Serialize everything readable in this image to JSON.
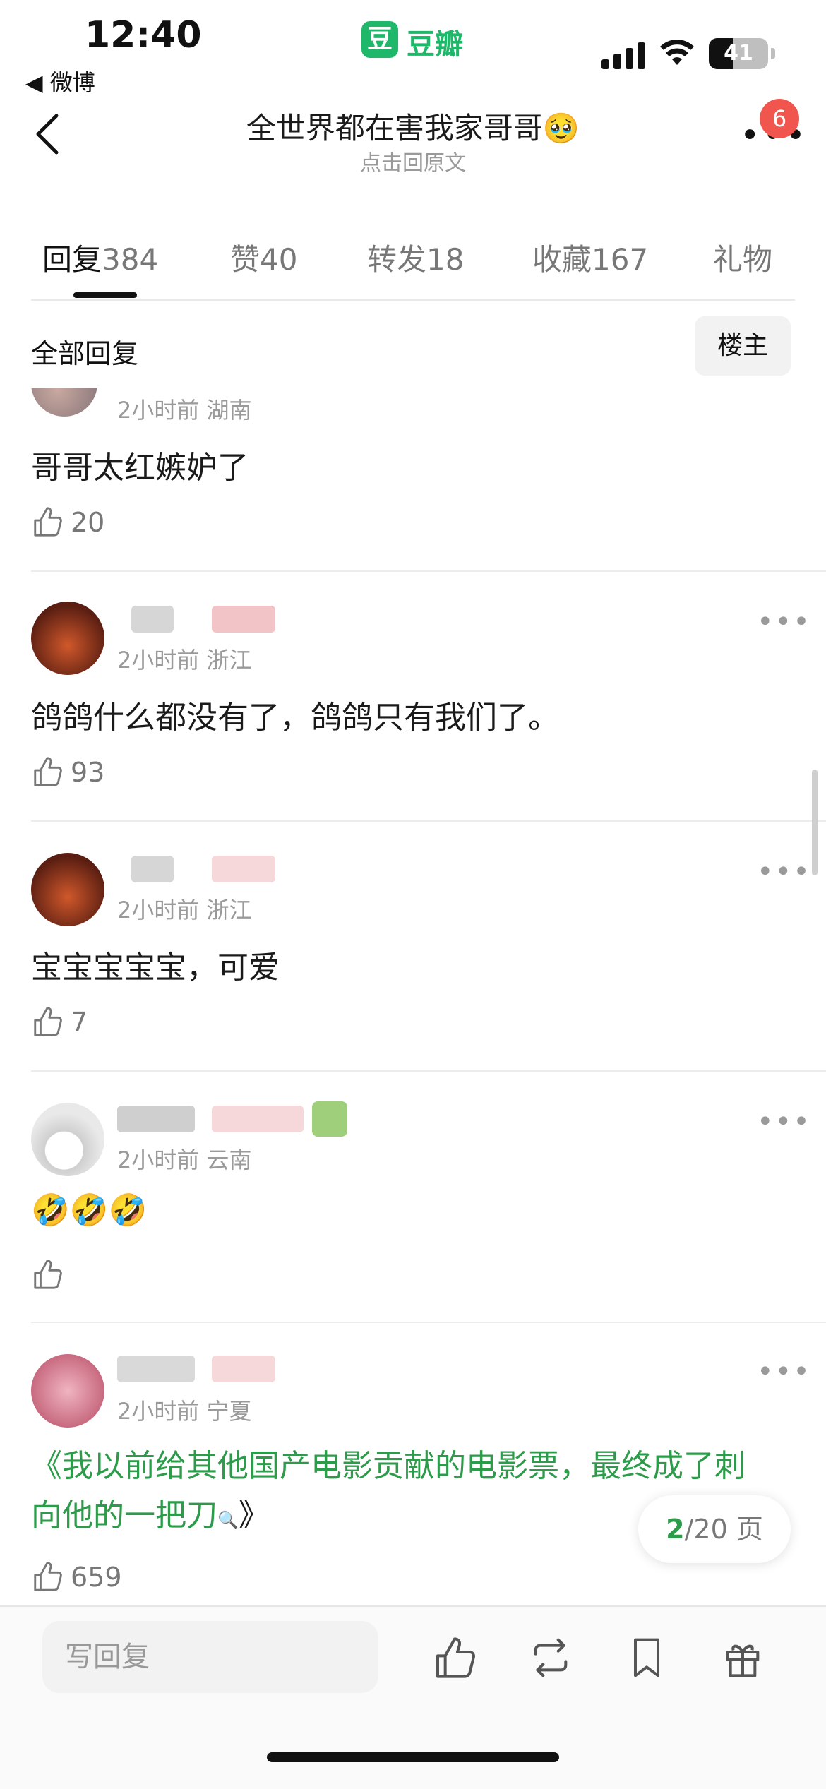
{
  "status_bar": {
    "time": "12:40",
    "back_app": "◀ 微博",
    "battery": "41",
    "battery_level": 0.41
  },
  "app": {
    "logo_char": "豆",
    "name": "豆瓣"
  },
  "nav": {
    "title": "全世界都在害我家哥哥🥹",
    "subtitle": "点击回原文",
    "badge": "6"
  },
  "tabs": [
    {
      "label": "回复",
      "count": "384"
    },
    {
      "label": "赞",
      "count": "40"
    },
    {
      "label": "转发",
      "count": "18"
    },
    {
      "label": "收藏",
      "count": "167"
    },
    {
      "label": "礼物",
      "count": ""
    }
  ],
  "filter": {
    "label": "全部回复",
    "button": "楼主"
  },
  "comments": [
    {
      "meta": "2小时前 湖南",
      "text": "哥哥太红嫉妒了",
      "likes": "20"
    },
    {
      "meta": "2小时前 浙江",
      "text": "鸽鸽什么都没有了，鸽鸽只有我们了。",
      "likes": "93"
    },
    {
      "meta": "2小时前 浙江",
      "text": "宝宝宝宝宝，可爱",
      "likes": "7"
    },
    {
      "meta": "2小时前 云南",
      "text": "🤣🤣🤣",
      "likes": ""
    },
    {
      "meta": "2小时前 宁夏",
      "text_line1": "《我以前给其他国产电影贡献的电影票，最终成了刺",
      "text_line2": "向他的一把刀",
      "likes": "659"
    }
  ],
  "pagination": {
    "current": "2",
    "total": "/20 页"
  },
  "bottom_bar": {
    "placeholder": "写回复"
  }
}
